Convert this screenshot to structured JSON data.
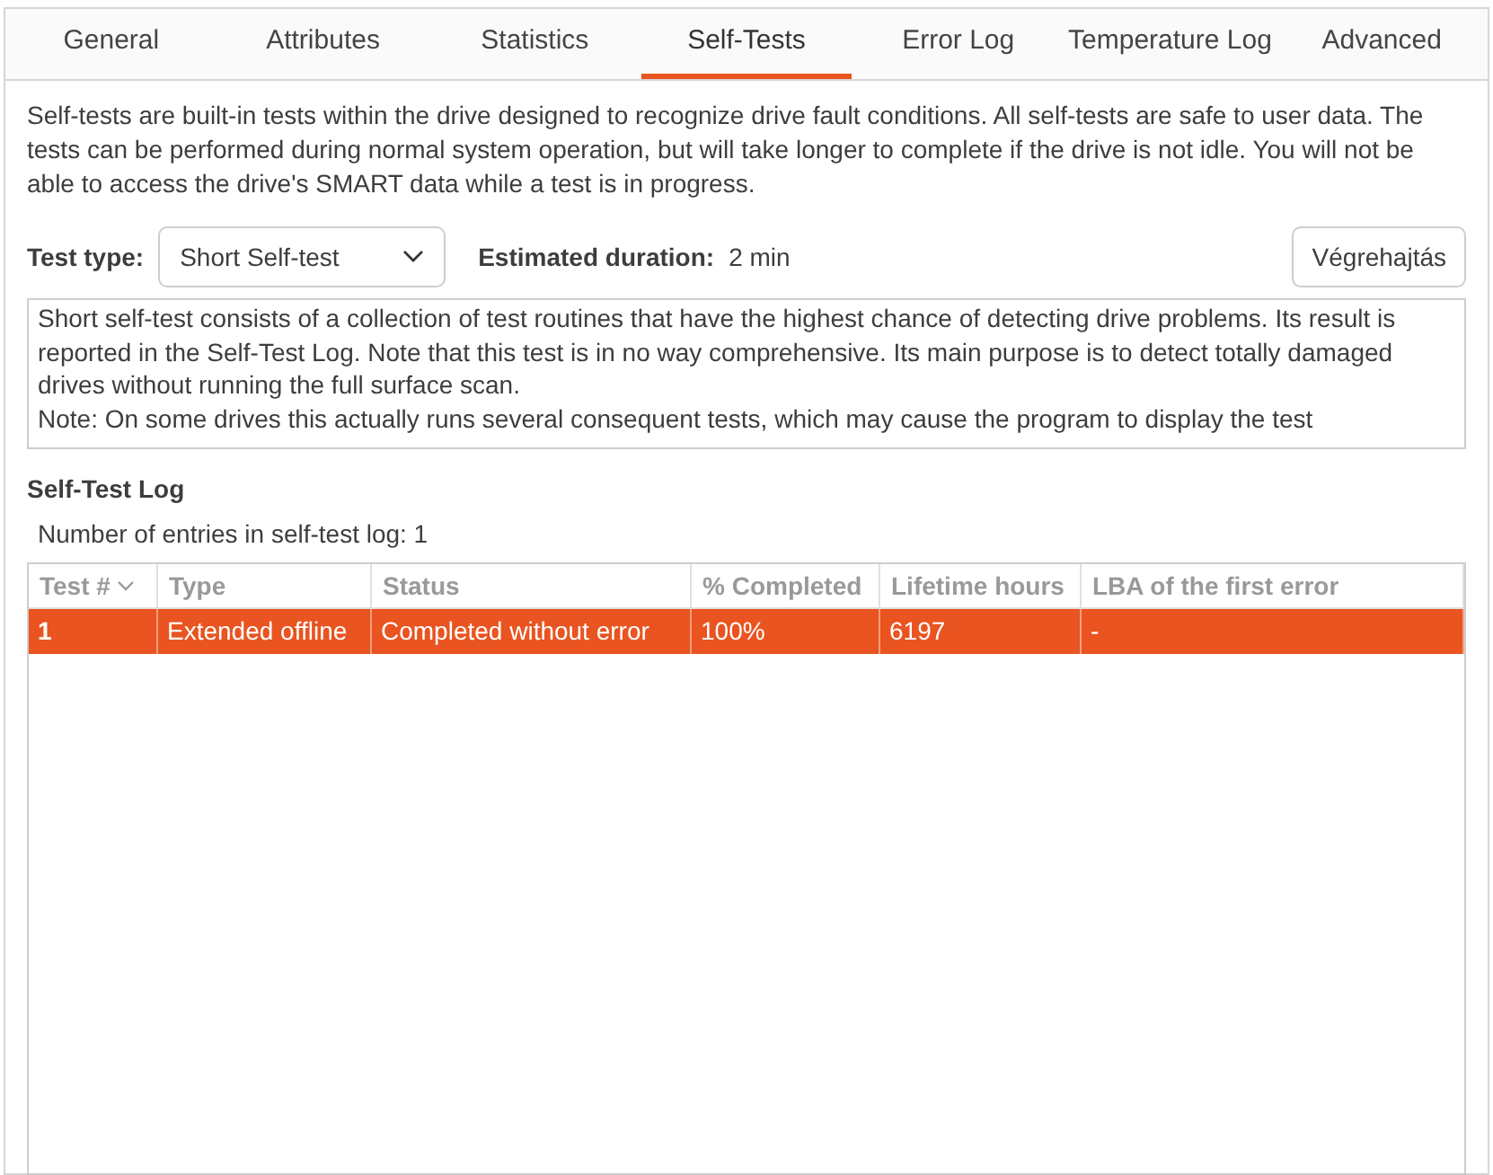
{
  "tabs": [
    {
      "label": "General",
      "selected": false
    },
    {
      "label": "Attributes",
      "selected": false
    },
    {
      "label": "Statistics",
      "selected": false
    },
    {
      "label": "Self-Tests",
      "selected": true
    },
    {
      "label": "Error Log",
      "selected": false
    },
    {
      "label": "Temperature Log",
      "selected": false
    },
    {
      "label": "Advanced",
      "selected": false
    }
  ],
  "intro": "Self-tests are built-in tests within the drive designed to recognize drive fault conditions. All self-tests are safe to user data. The tests can be performed during normal system operation, but will take longer to complete if the drive is not idle. You will not be able to access the drive's SMART data while a test is in progress.",
  "test_type": {
    "label": "Test type:",
    "value": "Short Self-test"
  },
  "duration": {
    "label": "Estimated duration:",
    "value": "2 min"
  },
  "run_button": "Végrehajtás",
  "description": [
    "Short self-test consists of a collection of test routines that have the highest chance of detecting drive problems. Its result is reported in the Self-Test Log. Note that this test is in no way comprehensive. Its main purpose is to detect totally damaged drives without running the full surface scan.",
    "Note: On some drives this actually runs several consequent tests, which may cause the program to display the test"
  ],
  "log": {
    "title": "Self-Test Log",
    "count": "Number of entries in self-test log: 1",
    "columns": [
      {
        "label": "Test #",
        "sorted": true
      },
      {
        "label": "Type",
        "sorted": false
      },
      {
        "label": "Status",
        "sorted": false
      },
      {
        "label": "% Completed",
        "sorted": false
      },
      {
        "label": "Lifetime hours",
        "sorted": false
      },
      {
        "label": "LBA of the first error",
        "sorted": false
      }
    ],
    "rows": [
      {
        "selected": true,
        "cells": [
          "1",
          "Extended offline",
          "Completed without error",
          "100%",
          "6197",
          "-"
        ]
      }
    ]
  }
}
